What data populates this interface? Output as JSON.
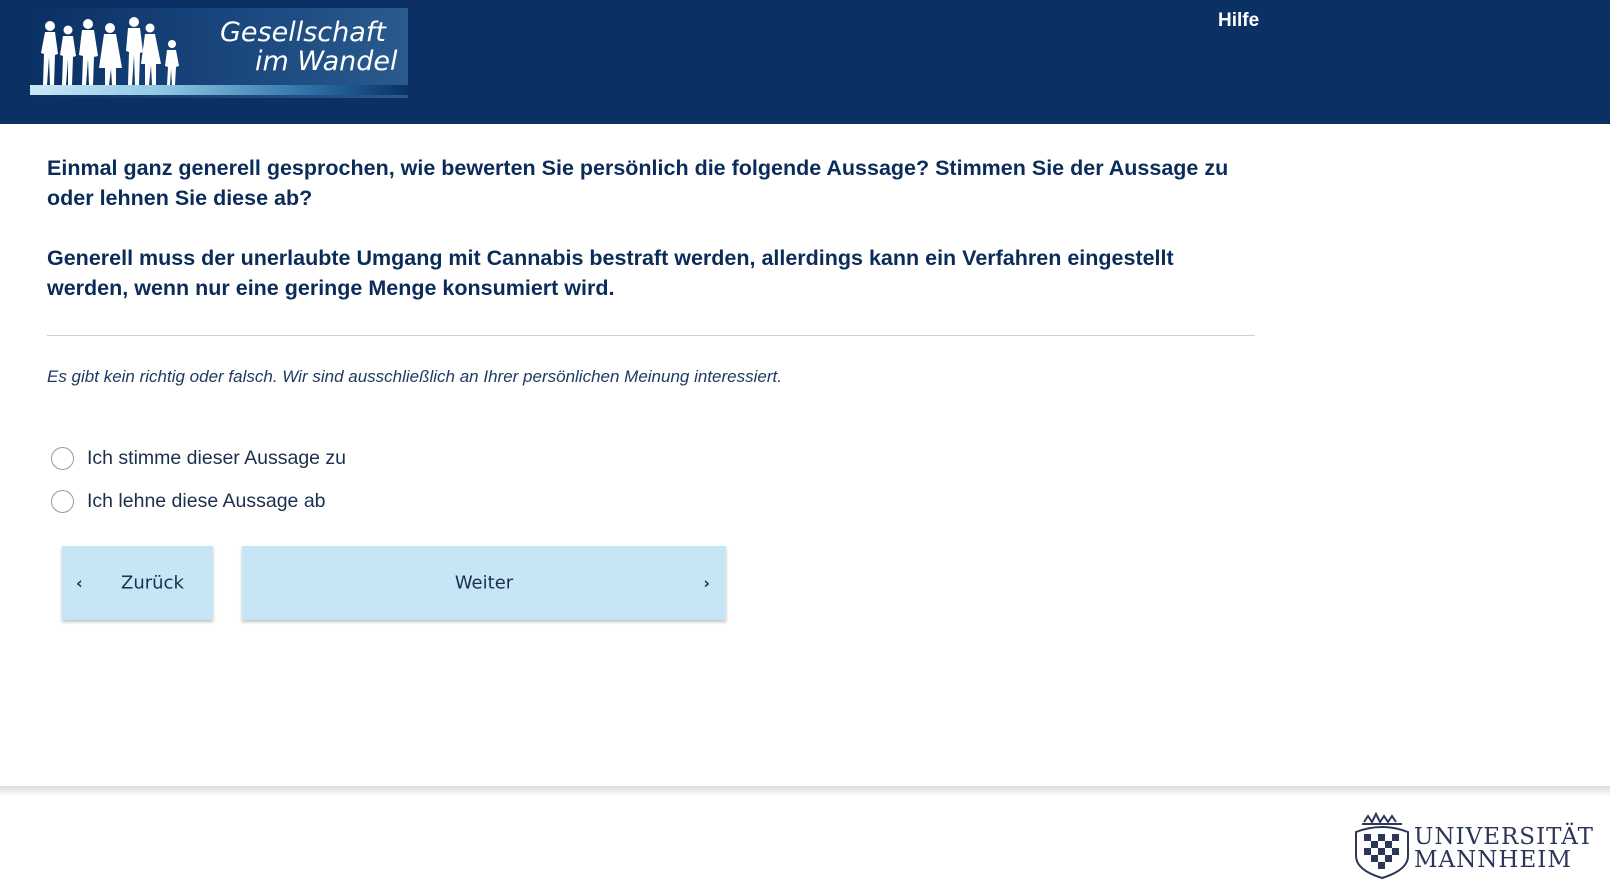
{
  "header": {
    "logo": {
      "line1": "Gesellschaft",
      "line2": "im Wandel",
      "icon": "people-silhouettes-icon"
    },
    "help_link": "Hilfe"
  },
  "question": {
    "text": "Einmal ganz generell gesprochen, wie bewerten Sie persönlich die folgende Aussage? Stimmen Sie der Aussage zu oder lehnen Sie diese ab?",
    "statement": "Generell muss der unerlaubte Umgang mit Cannabis bestraft werden, allerdings kann ein Verfahren eingestellt werden, wenn nur eine geringe Menge konsumiert wird.",
    "hint": "Es gibt kein richtig oder falsch. Wir sind ausschließlich an Ihrer persönlichen Meinung interessiert."
  },
  "options": [
    {
      "label": "Ich stimme dieser Aussage zu",
      "selected": false
    },
    {
      "label": "Ich lehne diese Aussage ab",
      "selected": false
    }
  ],
  "navigation": {
    "back_label": "Zurück",
    "next_label": "Weiter",
    "back_icon": "chevron-left-icon",
    "next_icon": "chevron-right-icon"
  },
  "footer": {
    "university_line1": "UNIVERSITÄT",
    "university_line2": "MANNHEIM",
    "crest_icon": "university-crest-icon"
  },
  "colors": {
    "header_bg": "#0a3064",
    "text": "#0b2c5a",
    "button_bg": "#c6e6f5"
  }
}
